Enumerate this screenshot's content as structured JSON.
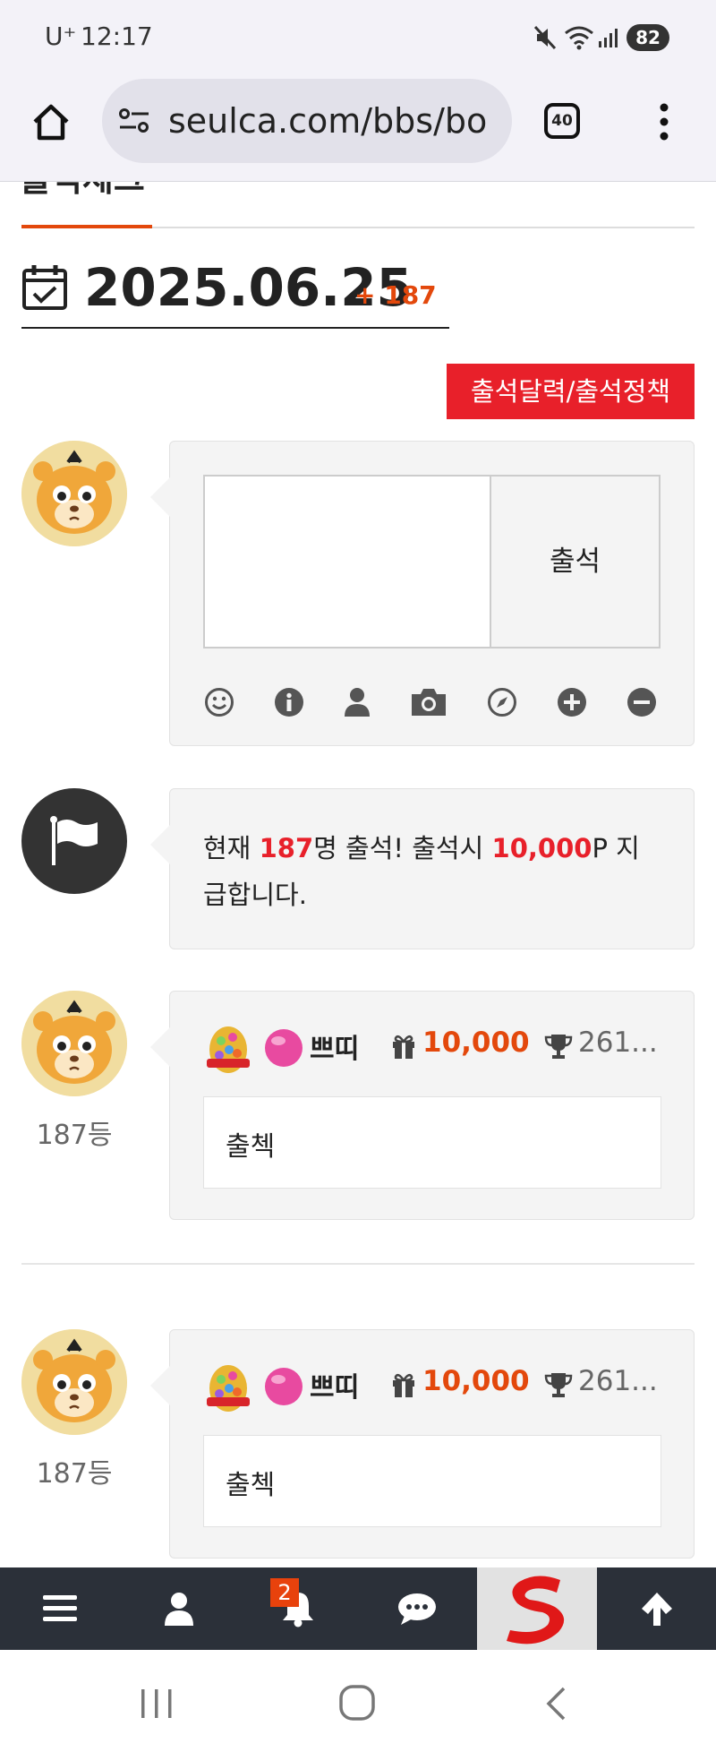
{
  "status_bar": {
    "carrier": "U⁺",
    "time": "12:17",
    "battery": "82"
  },
  "browser": {
    "url": "seulca.com/bbs/bo",
    "tab_count": "40"
  },
  "section_title": "출석체크",
  "date_header": {
    "date": "2025.06.25",
    "count": "+ 187"
  },
  "calendar_policy_button": "출석달력/출석정책",
  "attend_form": {
    "textarea_value": "",
    "submit_label": "출석"
  },
  "toolbar_icons": [
    "smiley-icon",
    "info-icon",
    "user-icon",
    "camera-icon",
    "compass-icon",
    "plus-circle-icon",
    "minus-circle-icon"
  ],
  "notice": {
    "prefix": "현재 ",
    "count": "187",
    "mid": "명 출석! 출석시 ",
    "points": "10,000",
    "suffix_line1": "P 지",
    "line2": "급합니다."
  },
  "entries": [
    {
      "rank": "187등",
      "nickname": "쁘띠",
      "points": "10,000",
      "trophy": "261...",
      "comment": "출첵"
    },
    {
      "rank": "187등",
      "nickname": "쁘띠",
      "points": "10,000",
      "trophy": "261...",
      "comment": "출첵"
    }
  ],
  "bottom_nav": {
    "notification_badge": "2"
  },
  "colors": {
    "accent_red": "#e8202a",
    "accent_orange": "#e3480c",
    "dark_nav": "#2b3039"
  }
}
